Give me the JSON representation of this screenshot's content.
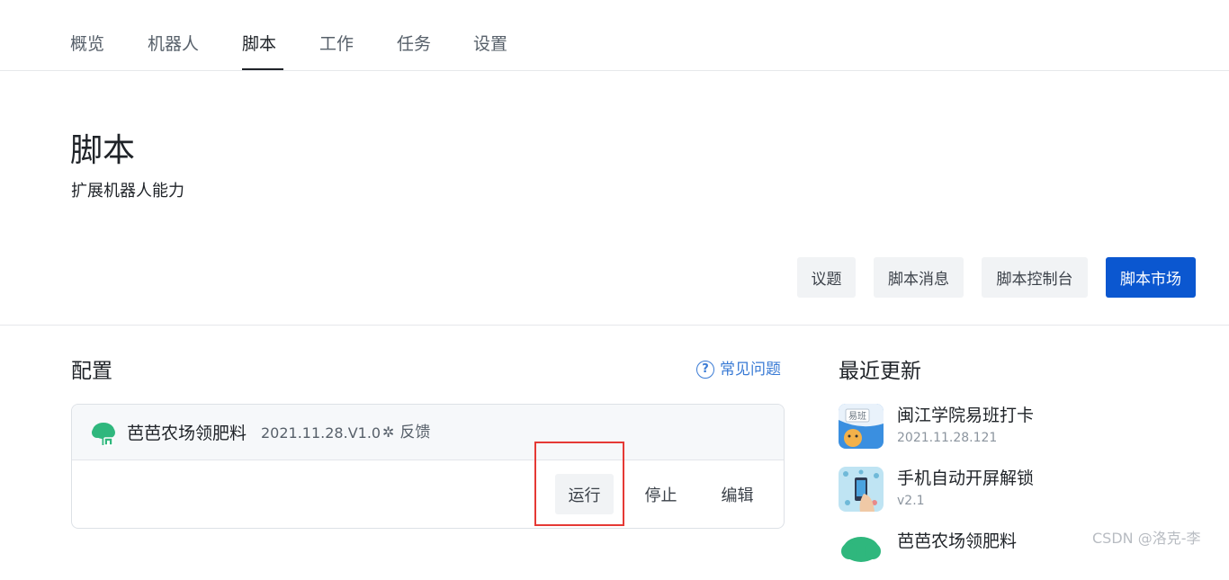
{
  "nav": {
    "tabs": [
      {
        "label": "概览"
      },
      {
        "label": "机器人"
      },
      {
        "label": "脚本"
      },
      {
        "label": "工作"
      },
      {
        "label": "任务"
      },
      {
        "label": "设置"
      }
    ],
    "active_tab": "脚本"
  },
  "header": {
    "title": "脚本",
    "subtitle": "扩展机器人能力"
  },
  "toolbar": {
    "issues_label": "议题",
    "messages_label": "脚本消息",
    "console_label": "脚本控制台",
    "market_label": "脚本市场"
  },
  "config": {
    "title": "配置",
    "faq_label": "常见问题",
    "script": {
      "name": "芭芭农场领肥料",
      "version": "2021.11.28.V1.0",
      "feedback_label": "反馈",
      "actions": {
        "run": "运行",
        "stop": "停止",
        "edit": "编辑"
      }
    }
  },
  "recent": {
    "title": "最近更新",
    "items": [
      {
        "name": "闽江学院易班打卡",
        "version": "2021.11.28.121",
        "icon": "yiban-app-icon"
      },
      {
        "name": "手机自动开屏解锁",
        "version": "v2.1",
        "icon": "phone-unlock-app-icon"
      },
      {
        "name": "芭芭农场领肥料",
        "version": "",
        "icon": "tree-app-icon"
      }
    ]
  },
  "watermark": "CSDN @洛克-李",
  "colors": {
    "primary": "#0b57d0",
    "link": "#3a7bd5",
    "highlight": "#e53935",
    "tree_green": "#2fb77d"
  }
}
